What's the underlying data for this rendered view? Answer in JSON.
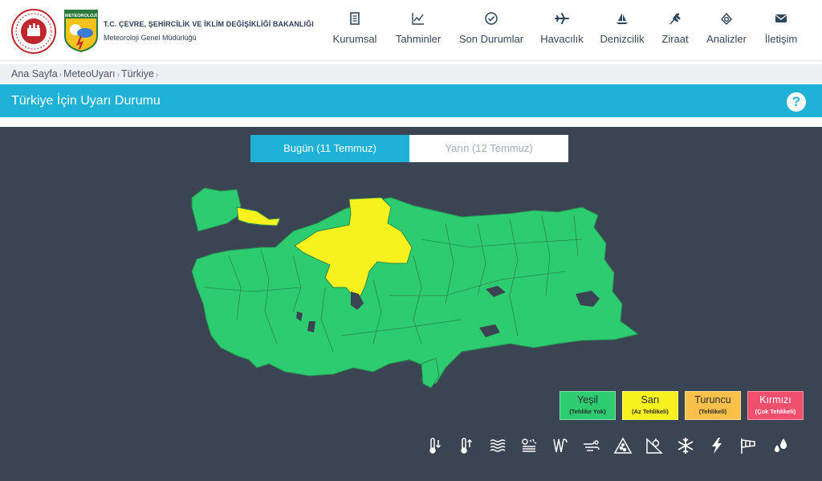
{
  "header": {
    "org_title": "T.C. ÇEVRE, ŞEHİRCİLİK VE İKLİM DEĞİŞİKLİĞİ BAKANLIĞI",
    "org_subtitle": "Meteoroloji Genel Müdürlüğü",
    "mgm_logo_text": "METEOROLOJİ",
    "nav": [
      {
        "label": "Kurumsal",
        "icon": "document-icon"
      },
      {
        "label": "Tahminler",
        "icon": "chart-icon"
      },
      {
        "label": "Son Durumlar",
        "icon": "check-circle-icon"
      },
      {
        "label": "Havacılık",
        "icon": "airplane-icon"
      },
      {
        "label": "Denizcilik",
        "icon": "sailboat-icon"
      },
      {
        "label": "Ziraat",
        "icon": "wheat-icon"
      },
      {
        "label": "Analizler",
        "icon": "analysis-icon"
      },
      {
        "label": "İletişim",
        "icon": "envelope-icon"
      }
    ]
  },
  "breadcrumb": [
    "Ana Sayfa",
    "MeteoUyarı",
    "Türkiye"
  ],
  "page": {
    "title": "Türkiye İçin Uyarı Durumu",
    "help": "?"
  },
  "tabs": {
    "today": "Bugün (11 Temmuz)",
    "tomorrow": "Yarın (12 Temmuz)",
    "active": "today"
  },
  "map": {
    "default_level": "Yeşil",
    "warned_level": "Sarı"
  },
  "legend": [
    {
      "name": "Yeşil",
      "desc": "(Tehlike Yok)",
      "color": "#2ecc71",
      "text_color": "#2b2b2b"
    },
    {
      "name": "Sarı",
      "desc": "(Az Tehlikeli)",
      "color": "#f7f21e",
      "text_color": "#2b2b2b"
    },
    {
      "name": "Turuncu",
      "desc": "(Tehlikeli)",
      "color": "#f9c04a",
      "text_color": "#2b2b2b"
    },
    {
      "name": "Kırmızı",
      "desc": "(Çok Tehlikeli)",
      "color": "#f0506e",
      "text_color": "#ffffff"
    }
  ],
  "hazards": [
    "low-temperature-icon",
    "high-temperature-icon",
    "fog-icon",
    "dust-icon",
    "wind-icon",
    "storm-icon",
    "avalanche-icon",
    "icing-icon",
    "snow-icon",
    "lightning-icon",
    "windsock-icon",
    "rain-icon"
  ],
  "colors": {
    "accent": "#1fb2d6",
    "map_background": "#3b4452",
    "province_green": "#2ecc71",
    "province_yellow": "#f7f21e",
    "water": "#3b4452"
  }
}
